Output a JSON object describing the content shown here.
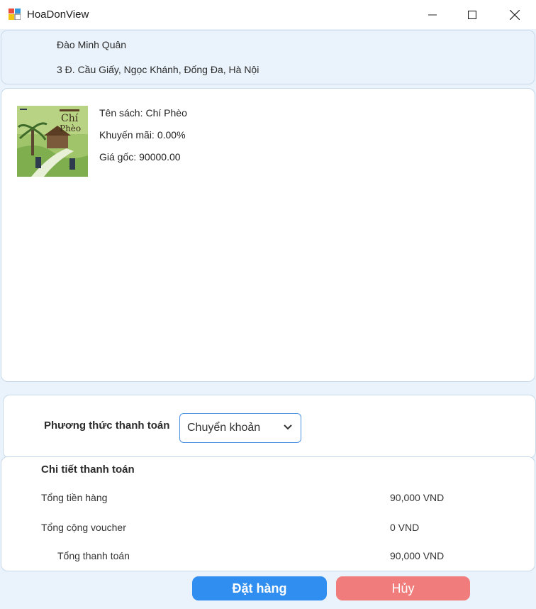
{
  "window": {
    "title": "HoaDonView"
  },
  "customer": {
    "name": "Đào Minh Quân",
    "address": "3 Đ. Cầu Giấy, Ngọc Khánh, Đống Đa, Hà Nội"
  },
  "items": [
    {
      "title_label": "Tên sách:",
      "title": "Chí Phèo",
      "discount_label": "Khuyến mãi:",
      "discount": "0.00%",
      "price_label": "Giá gốc:",
      "price": "90000.00",
      "cover_icon": "book-cover-image"
    }
  ],
  "payment": {
    "label": "Phương thức thanh toán",
    "selected": "Chuyển khoản"
  },
  "details": {
    "title": "Chi tiết thanh toán",
    "subtotal_label": "Tổng tiền hàng",
    "subtotal_value": "90,000 VND",
    "voucher_label": "Tổng cộng voucher",
    "voucher_value": "0 VND",
    "total_label": "Tổng thanh toán",
    "total_value": "90,000 VND"
  },
  "actions": {
    "order_label": "Đặt hàng",
    "cancel_label": "Hủy"
  },
  "colors": {
    "order_button": "#2f8ef0",
    "cancel_button": "#f07c7c",
    "select_border": "#4a90e2"
  }
}
